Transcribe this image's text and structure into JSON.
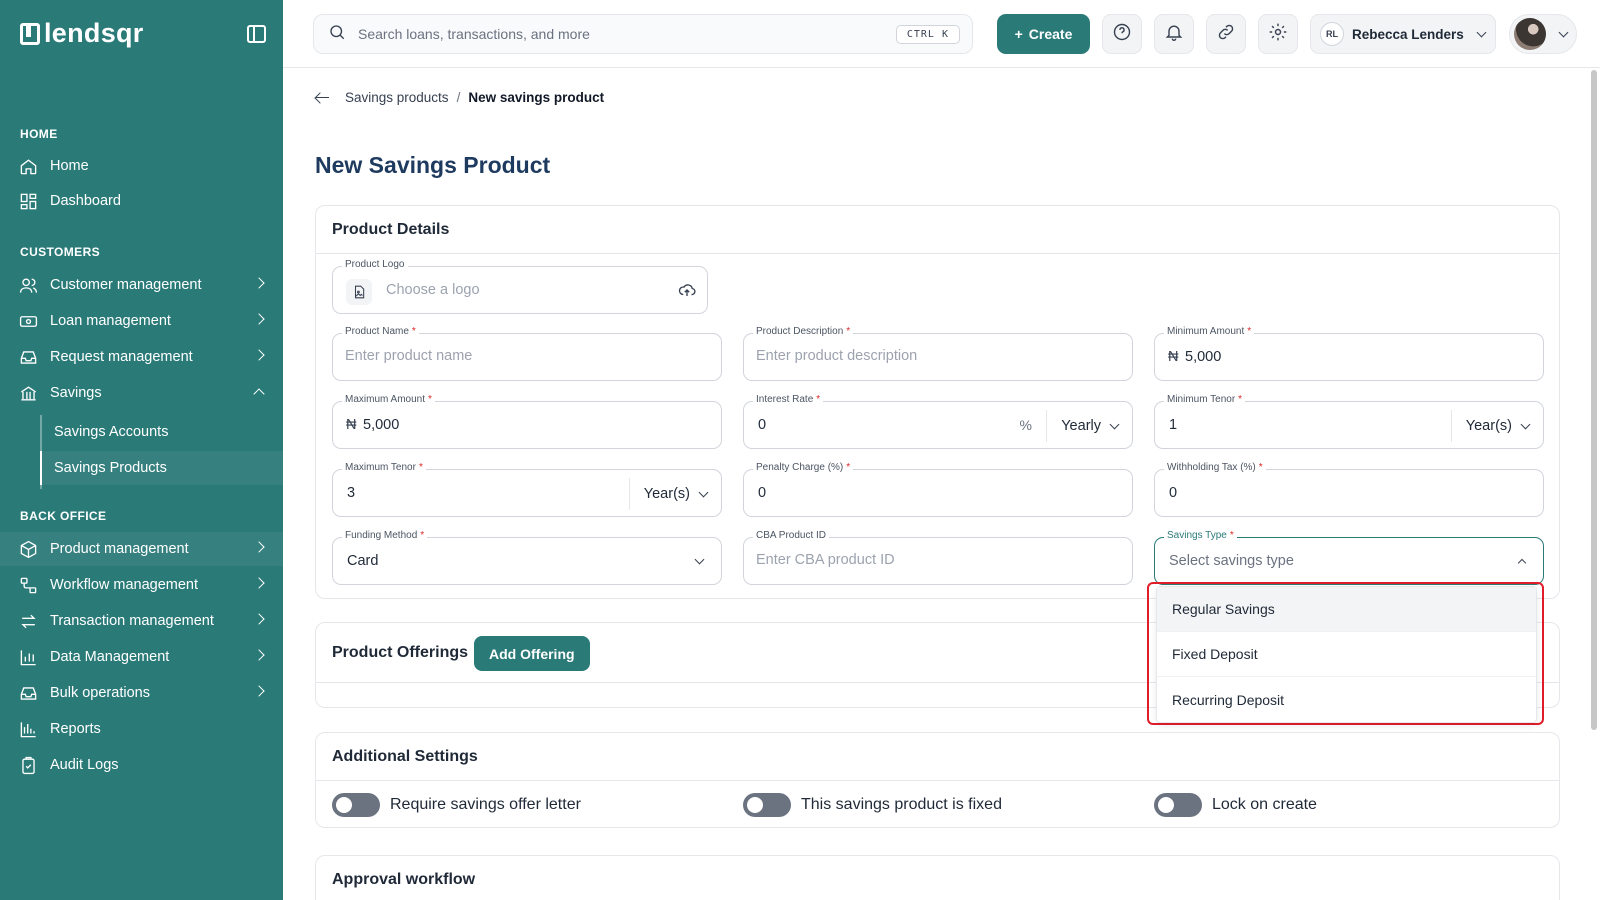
{
  "brand": {
    "name": "lendsqr",
    "accent": "#2a7a78",
    "highlight_border": "#e11d2a"
  },
  "sidebar": {
    "sections": [
      {
        "label": "HOME"
      },
      {
        "label": "CUSTOMERS"
      },
      {
        "label": "BACK OFFICE"
      }
    ],
    "items": [
      {
        "label": "Home",
        "icon": "home-icon"
      },
      {
        "label": "Dashboard",
        "icon": "dashboard-icon"
      },
      {
        "label": "Customer management",
        "icon": "users-icon"
      },
      {
        "label": "Loan management",
        "icon": "loan-icon"
      },
      {
        "label": "Request management",
        "icon": "inbox-icon"
      },
      {
        "label": "Savings",
        "icon": "savings-icon"
      },
      {
        "label": "Product management",
        "icon": "box-icon"
      },
      {
        "label": "Workflow management",
        "icon": "workflow-icon"
      },
      {
        "label": "Transaction management",
        "icon": "transfer-icon"
      },
      {
        "label": "Data Management",
        "icon": "chart-icon"
      },
      {
        "label": "Bulk operations",
        "icon": "bulk-icon"
      },
      {
        "label": "Reports",
        "icon": "reports-icon"
      },
      {
        "label": "Audit Logs",
        "icon": "clipboard-icon"
      }
    ],
    "savings_sub": [
      {
        "label": "Savings Accounts"
      },
      {
        "label": "Savings Products"
      }
    ]
  },
  "topbar": {
    "search_placeholder": "Search loans, transactions, and more",
    "shortcut": "CTRL K",
    "create_label": "Create",
    "user_initials": "RL",
    "user_name": "Rebecca Lenders"
  },
  "breadcrumb": {
    "parent": "Savings products",
    "separator": "/",
    "current": "New savings product"
  },
  "page_title": "New Savings Product",
  "product_details": {
    "title": "Product Details",
    "logo_label": "Product Logo",
    "logo_placeholder": "Choose a logo",
    "fields": {
      "product_name": {
        "label": "Product Name",
        "placeholder": "Enter product name"
      },
      "product_description": {
        "label": "Product Description",
        "placeholder": "Enter product description"
      },
      "minimum_amount": {
        "label": "Minimum Amount",
        "currency": "₦",
        "value": "5,000"
      },
      "maximum_amount": {
        "label": "Maximum Amount",
        "currency": "₦",
        "value": "5,000"
      },
      "interest_rate": {
        "label": "Interest Rate",
        "value": "0",
        "unit": "%",
        "period": "Yearly"
      },
      "minimum_tenor": {
        "label": "Minimum Tenor",
        "value": "1",
        "unit": "Year(s)"
      },
      "maximum_tenor": {
        "label": "Maximum Tenor",
        "value": "3",
        "unit": "Year(s)"
      },
      "penalty_charge": {
        "label": "Penalty Charge (%)",
        "value": "0"
      },
      "withholding_tax": {
        "label": "Withholding Tax (%)",
        "value": "0"
      },
      "funding_method": {
        "label": "Funding Method",
        "value": "Card"
      },
      "cba_product_id": {
        "label": "CBA Product ID",
        "placeholder": "Enter CBA product ID"
      },
      "savings_type": {
        "label": "Savings Type",
        "placeholder": "Select savings type"
      }
    },
    "required_mark": "*"
  },
  "savings_type_options": [
    {
      "label": "Regular Savings"
    },
    {
      "label": "Fixed Deposit"
    },
    {
      "label": "Recurring Deposit"
    }
  ],
  "product_offerings": {
    "title": "Product Offerings",
    "add_label": "Add Offering"
  },
  "additional_settings": {
    "title": "Additional Settings",
    "toggles": [
      {
        "label": "Require savings offer letter",
        "on": false
      },
      {
        "label": "This savings product is fixed",
        "on": false
      },
      {
        "label": "Lock on create",
        "on": false
      }
    ]
  },
  "approval_workflow": {
    "title": "Approval workflow"
  }
}
